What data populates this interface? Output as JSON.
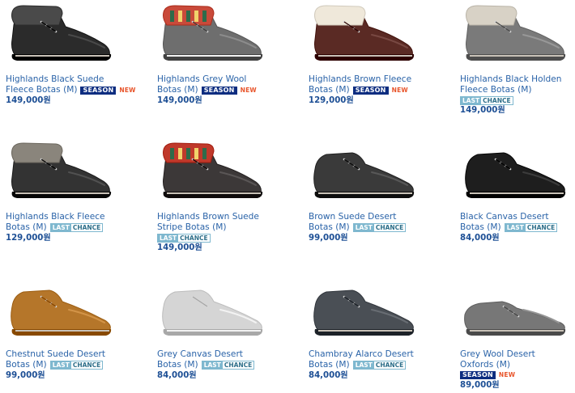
{
  "badges": {
    "season": "SEASON",
    "new": "NEW",
    "last": "LAST",
    "chance": "CHANCE"
  },
  "products": [
    {
      "name_line1": "Highlands Black Suede",
      "name_line2": "Fleece Botas (M)",
      "badge": "season_new",
      "price": "149,000원",
      "color": "#2b2b2b",
      "icon": "shoe-black-suede-fleece-icon"
    },
    {
      "name_line1": "Highlands Grey Wool",
      "name_line2": "Botas (M)",
      "badge": "season_new",
      "price": "149,000원",
      "color": "#6e6e6e",
      "icon": "shoe-grey-wool-icon"
    },
    {
      "name_line1": "Highlands Brown Fleece",
      "name_line2": "Botas (M)",
      "badge": "season_new",
      "price": "129,000원",
      "color": "#5a2a24",
      "icon": "shoe-brown-fleece-icon"
    },
    {
      "name_line1": "Highlands Black Holden",
      "name_line2": "Fleece Botas (M)",
      "badge": "last_chance",
      "price": "149,000원",
      "color": "#7a7a7a",
      "icon": "shoe-black-holden-fleece-icon"
    },
    {
      "name_line1": "Highlands Black Fleece",
      "name_line2": "Botas (M)",
      "badge": "last_chance",
      "price": "129,000원",
      "color": "#333333",
      "icon": "shoe-black-fleece-icon"
    },
    {
      "name_line1": "Highlands Brown Suede",
      "name_line2": "Stripe Botas (M)",
      "badge": "last_chance",
      "price": "149,000원",
      "color": "#3c3838",
      "icon": "shoe-brown-suede-stripe-icon"
    },
    {
      "name_line1": "Brown Suede Desert",
      "name_line2": "Botas (M)",
      "badge": "last_chance",
      "price": "99,000원",
      "color": "#3a3a3a",
      "icon": "shoe-brown-suede-desert-icon"
    },
    {
      "name_line1": "Black Canvas Desert",
      "name_line2": "Botas (M)",
      "badge": "last_chance",
      "price": "84,000원",
      "color": "#1e1e1e",
      "icon": "shoe-black-canvas-desert-icon"
    },
    {
      "name_line1": "Chestnut Suede Desert",
      "name_line2": "Botas (M)",
      "badge": "last_chance",
      "price": "99,000원",
      "color": "#b5762a",
      "icon": "shoe-chestnut-suede-desert-icon"
    },
    {
      "name_line1": "Grey Canvas Desert",
      "name_line2": "Botas (M)",
      "badge": "last_chance",
      "price": "84,000원",
      "color": "#d5d5d5",
      "icon": "shoe-grey-canvas-desert-icon"
    },
    {
      "name_line1": "Chambray Alarco Desert",
      "name_line2": "Botas (M)",
      "badge": "last_chance",
      "price": "84,000원",
      "color": "#4a4f55",
      "icon": "shoe-chambray-alarco-desert-icon"
    },
    {
      "name_line1": "Grey Wool Desert",
      "name_line2": "Oxfords (M)",
      "badge": "season_new",
      "price": "89,000원",
      "color": "#777777",
      "icon": "shoe-grey-wool-oxford-icon"
    }
  ]
}
